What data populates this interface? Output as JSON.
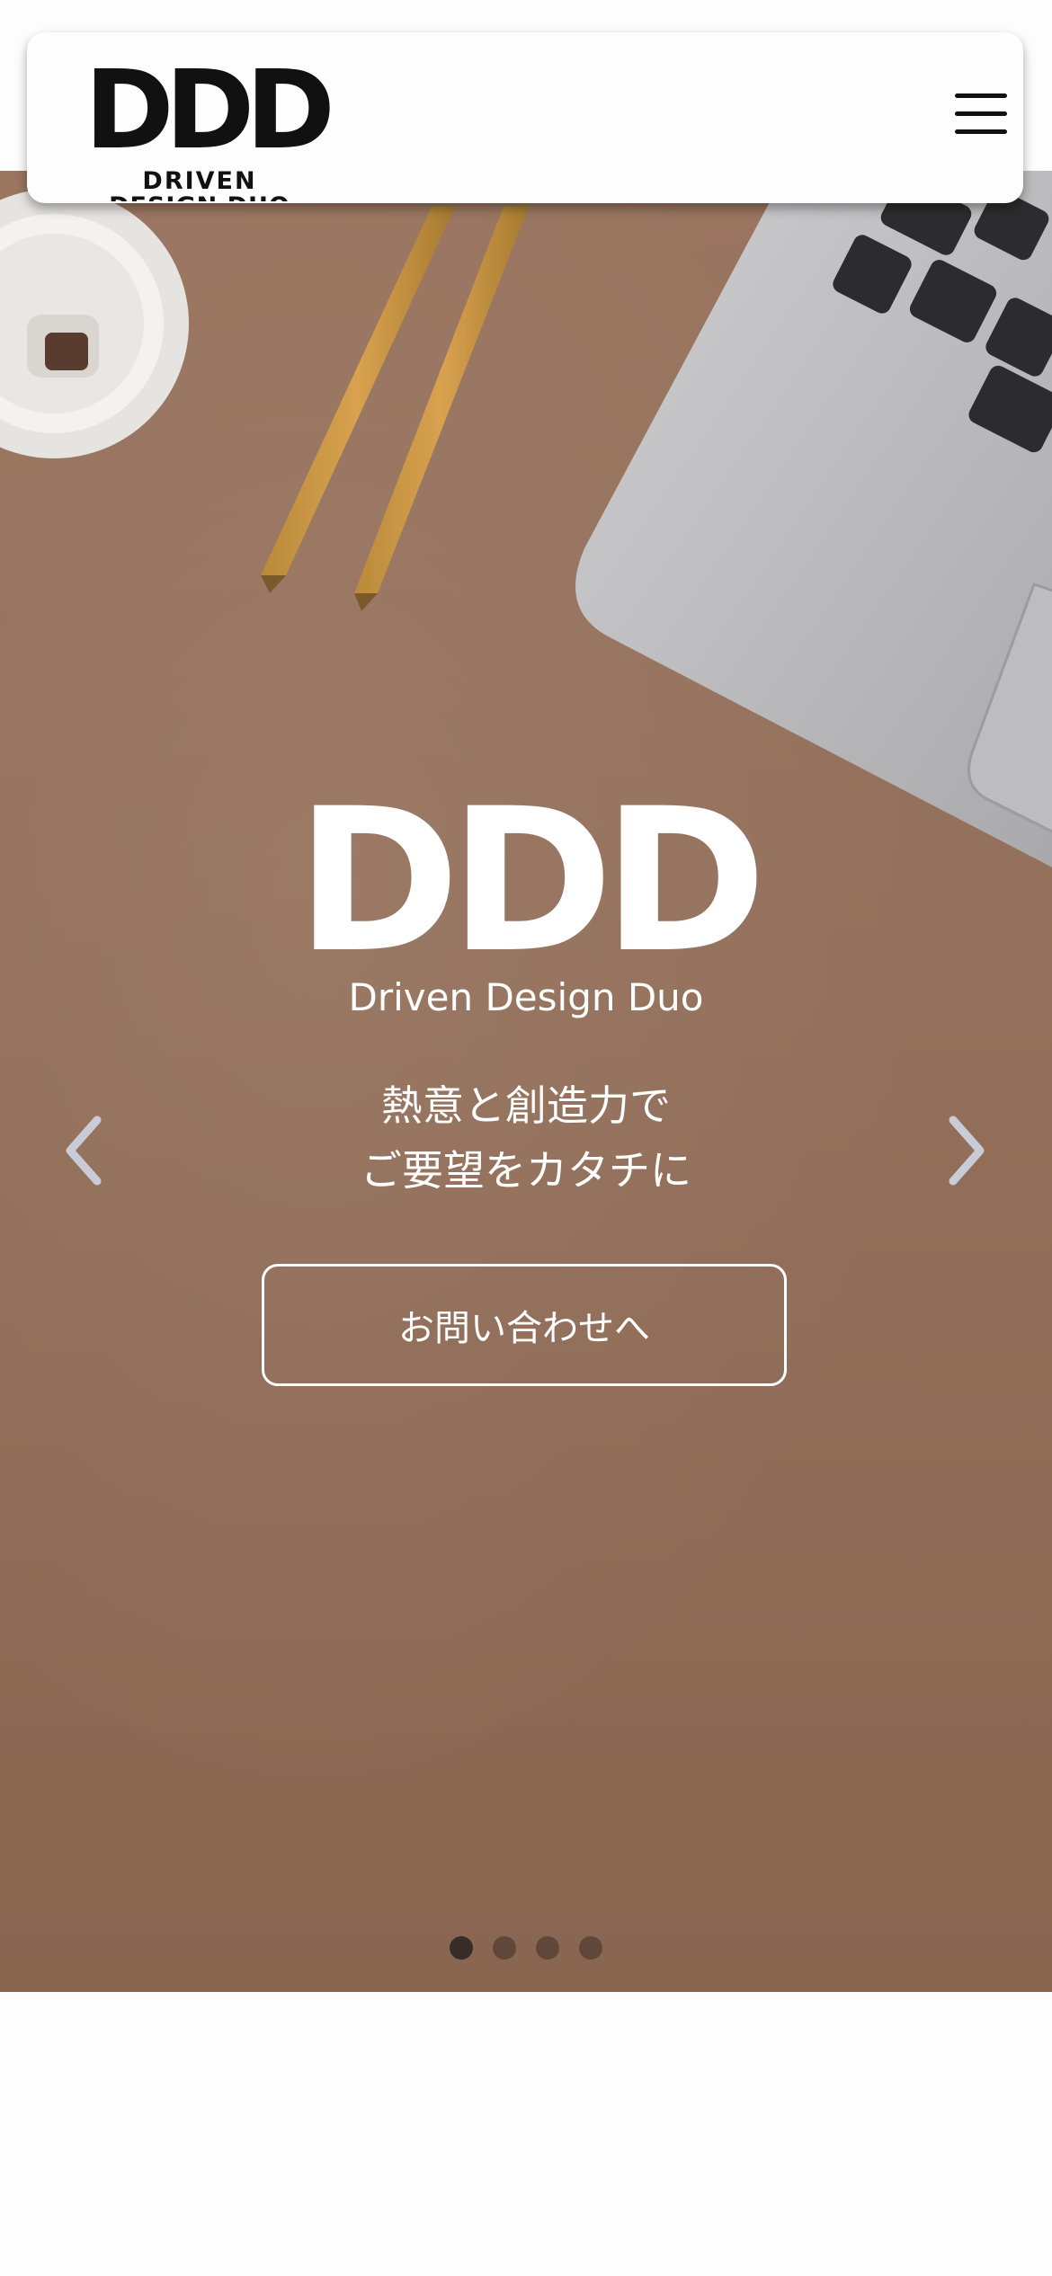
{
  "header": {
    "logo_mark": "DDD",
    "logo_line1": "DRIVEN",
    "logo_line2": "DESIGN DUO"
  },
  "hero": {
    "title": "DDD",
    "subtitle": "Driven Design Duo",
    "tagline_line1": "熱意と創造力で",
    "tagline_line2": "ご要望をカタチに",
    "cta_label": "お問い合わせへ"
  },
  "carousel": {
    "slide_count": 4,
    "active_index": 0
  },
  "icons": {
    "menu": "hamburger-menu-icon",
    "prev": "chevron-left-icon",
    "next": "chevron-right-icon"
  },
  "colors": {
    "hero_background": "#93705b",
    "header_background": "#fdfdfd",
    "text_on_hero": "#ffffff",
    "logo": "#111111"
  }
}
